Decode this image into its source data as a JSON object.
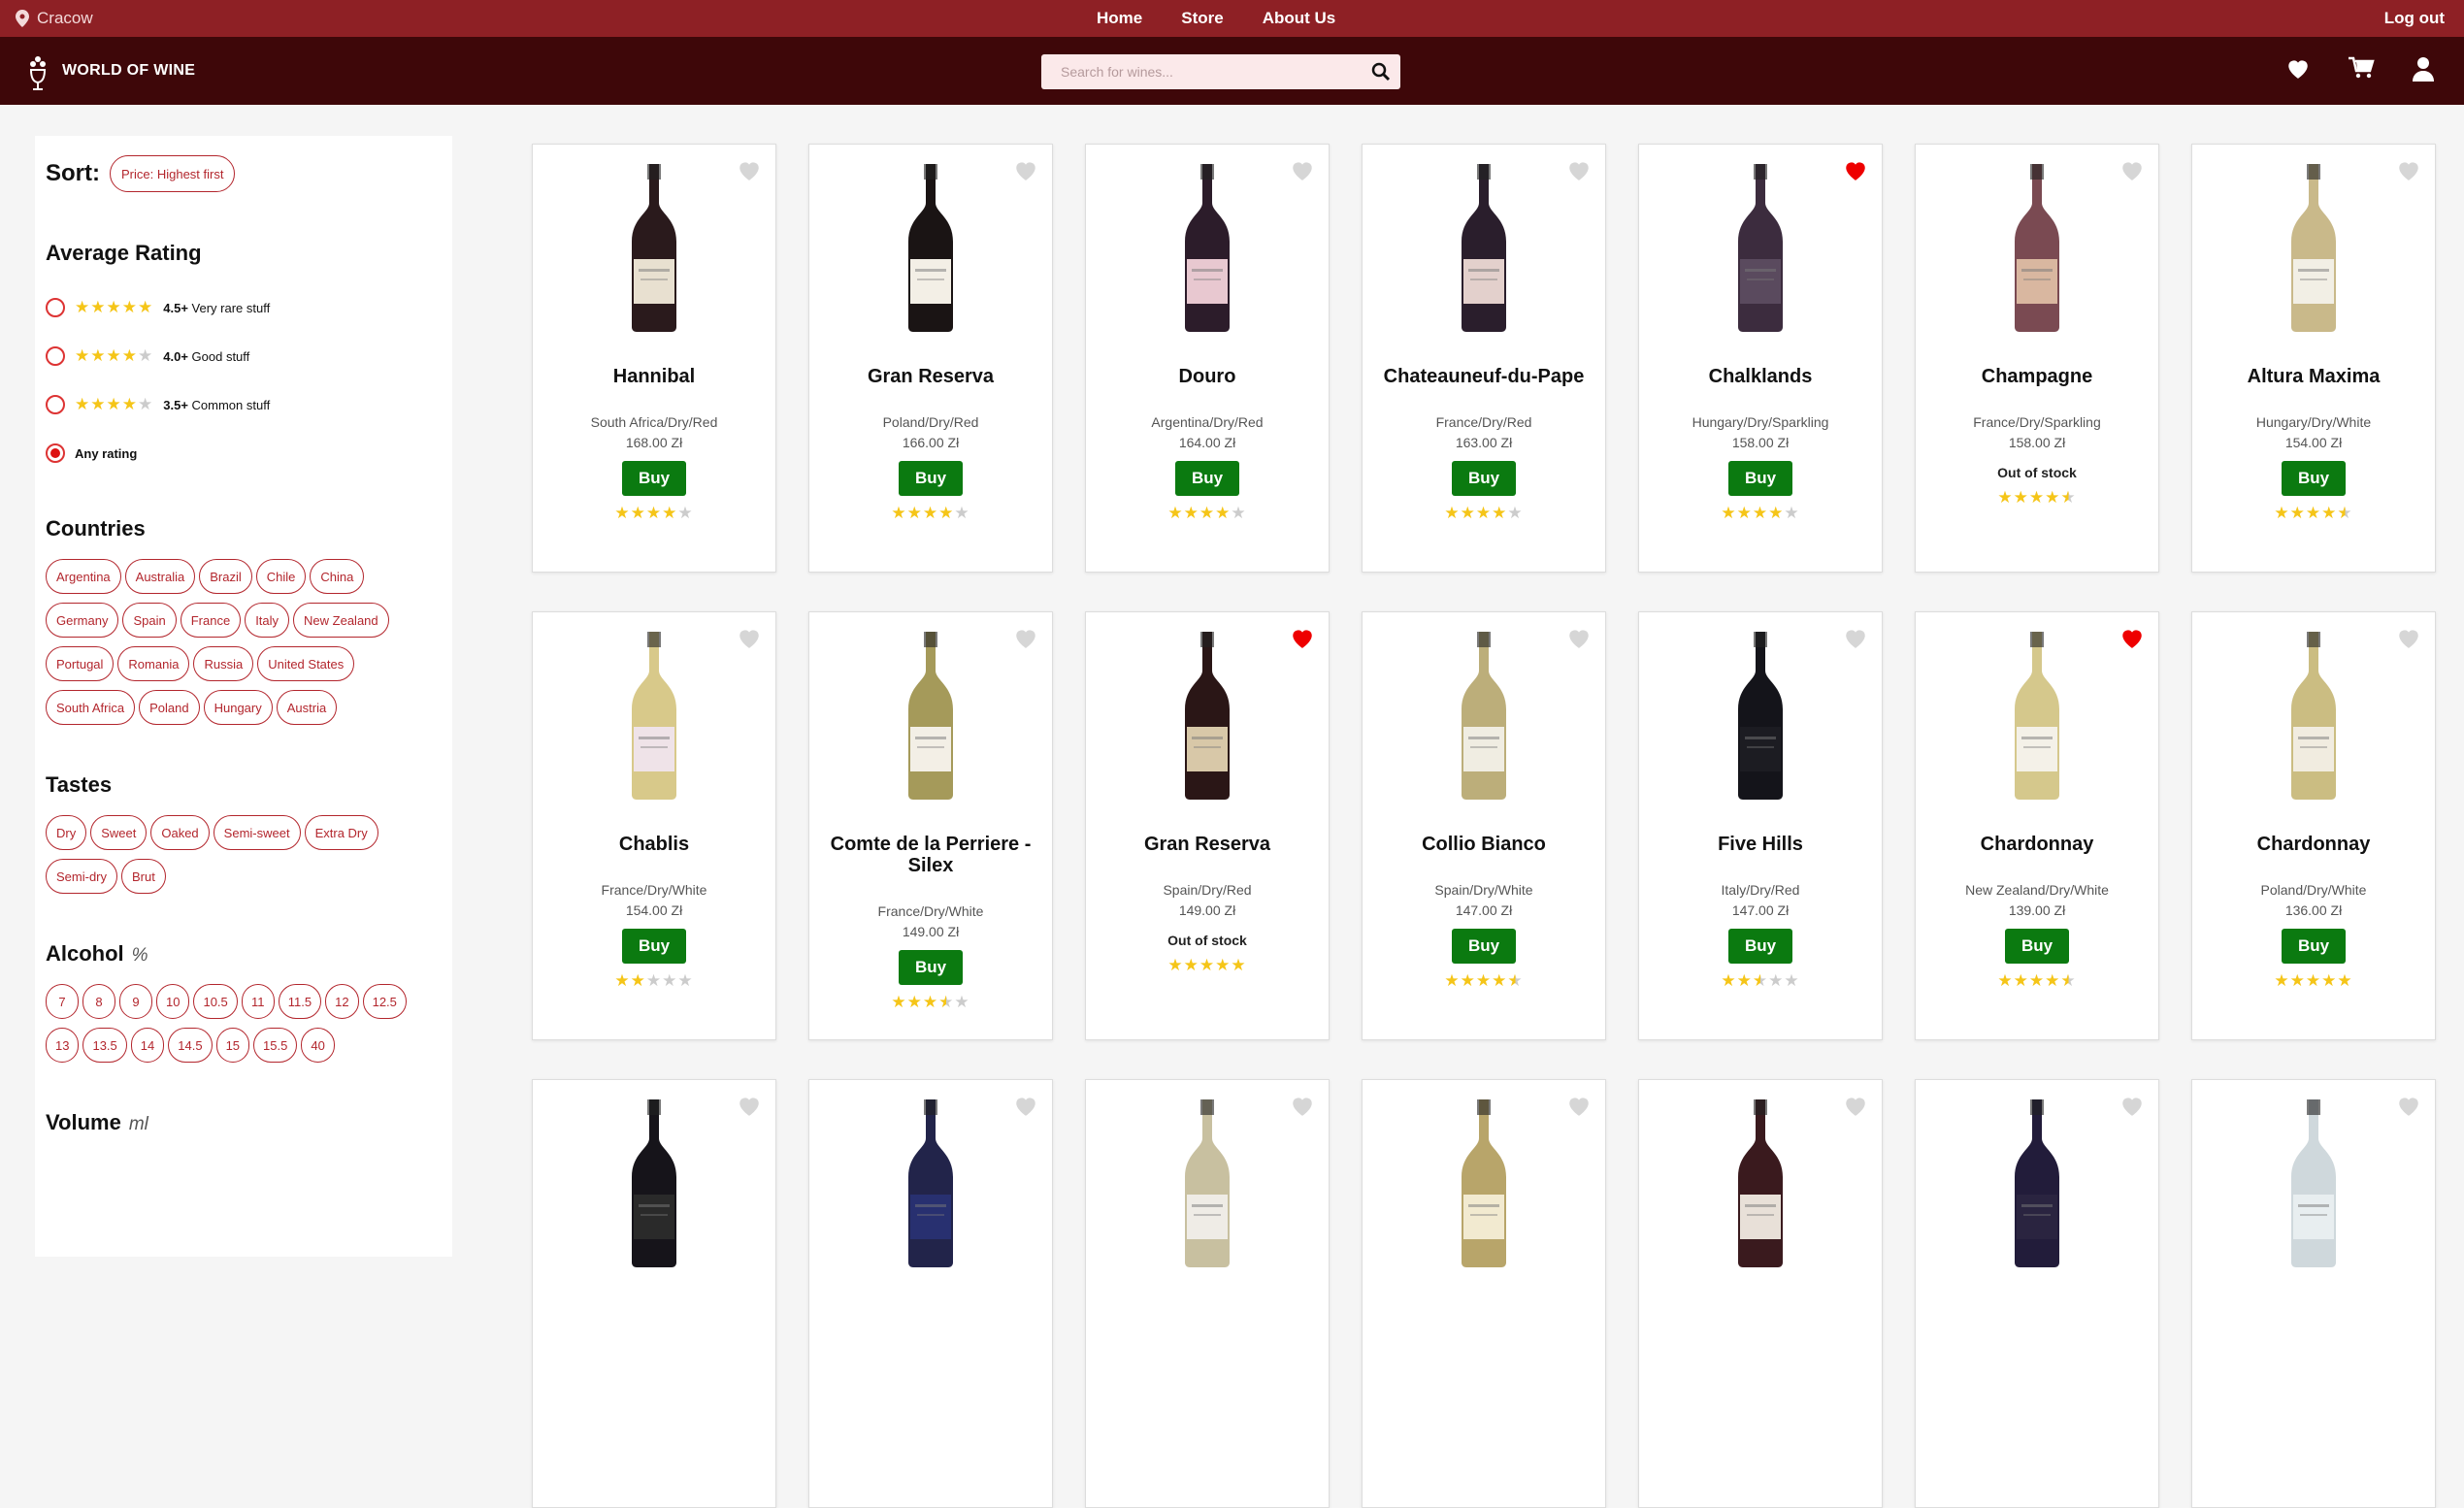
{
  "topbar": {
    "location": "Cracow",
    "nav": [
      "Home",
      "Store",
      "About Us"
    ],
    "logout": "Log out"
  },
  "header": {
    "brand": "WORLD OF WINE",
    "search_placeholder": "Search for wines..."
  },
  "sidebar": {
    "sort_label": "Sort:",
    "sort_value": "Price: Highest first",
    "rating_title": "Average Rating",
    "ratings": [
      {
        "stars": 4.5,
        "value": "4.5+",
        "text": "Very rare stuff",
        "selected": false
      },
      {
        "stars": 4,
        "value": "4.0+",
        "text": "Good stuff",
        "selected": false
      },
      {
        "stars": 3.5,
        "value": "3.5+",
        "text": "Common stuff",
        "selected": false
      },
      {
        "stars": 0,
        "value": "",
        "text": "Any rating",
        "selected": true
      }
    ],
    "countries_title": "Countries",
    "countries": [
      "Argentina",
      "Australia",
      "Brazil",
      "Chile",
      "China",
      "Germany",
      "Spain",
      "France",
      "Italy",
      "New Zealand",
      "Portugal",
      "Romania",
      "Russia",
      "United States",
      "South Africa",
      "Poland",
      "Hungary",
      "Austria"
    ],
    "tastes_title": "Tastes",
    "tastes": [
      "Dry",
      "Sweet",
      "Oaked",
      "Semi-sweet",
      "Extra Dry",
      "Semi-dry",
      "Brut"
    ],
    "alcohol_title": "Alcohol",
    "alcohol_unit": "%",
    "alcohol": [
      "7",
      "8",
      "9",
      "10",
      "10.5",
      "11",
      "11.5",
      "12",
      "12.5",
      "13",
      "13.5",
      "14",
      "14.5",
      "15",
      "15.5",
      "40"
    ],
    "volume_title": "Volume",
    "volume_unit": "ml"
  },
  "products": [
    {
      "name": "Hannibal",
      "meta": "South Africa/Dry/Red",
      "price": "168.00 Zł",
      "buy": "Buy",
      "rating": 4,
      "fav": false,
      "stock": true,
      "color": "#2a1a1c",
      "label": "#e8e0d0"
    },
    {
      "name": "Gran Reserva",
      "meta": "Poland/Dry/Red",
      "price": "166.00 Zł",
      "buy": "Buy",
      "rating": 4,
      "fav": false,
      "stock": true,
      "color": "#1a1414",
      "label": "#f3efe6"
    },
    {
      "name": "Douro",
      "meta": "Argentina/Dry/Red",
      "price": "164.00 Zł",
      "buy": "Buy",
      "rating": 4,
      "fav": false,
      "stock": true,
      "color": "#2c1c2a",
      "label": "#e8c8d0"
    },
    {
      "name": "Chateauneuf-du-Pape",
      "meta": "France/Dry/Red",
      "price": "163.00 Zł",
      "buy": "Buy",
      "rating": 4,
      "fav": false,
      "stock": true,
      "color": "#2a1e2c",
      "label": "#e3d0cc"
    },
    {
      "name": "Chalklands",
      "meta": "Hungary/Dry/Sparkling",
      "price": "158.00 Zł",
      "buy": "Buy",
      "rating": 4,
      "fav": true,
      "stock": true,
      "color": "#3c2c3e",
      "label": "#5a4a5e"
    },
    {
      "name": "Champagne",
      "meta": "France/Dry/Sparkling",
      "price": "158.00 Zł",
      "buy": "Buy",
      "rating": 4.5,
      "fav": false,
      "stock": false,
      "out_of_stock": "Out of stock",
      "color": "#7a4a52",
      "label": "#d9b7a0"
    },
    {
      "name": "Altura Maxima",
      "meta": "Hungary/Dry/White",
      "price": "154.00 Zł",
      "buy": "Buy",
      "rating": 4.5,
      "fav": false,
      "stock": true,
      "color": "#c9b98a",
      "label": "#f2efe5"
    },
    {
      "name": "Chablis",
      "meta": "France/Dry/White",
      "price": "154.00 Zł",
      "buy": "Buy",
      "rating": 2,
      "fav": false,
      "stock": true,
      "color": "#d8c98a",
      "label": "#efe3e8"
    },
    {
      "name": "Comte de la Perriere - Silex",
      "meta": "France/Dry/White",
      "price": "149.00 Zł",
      "buy": "Buy",
      "rating": 3.5,
      "fav": false,
      "stock": true,
      "color": "#a59a5a",
      "label": "#f3efe6"
    },
    {
      "name": "Gran Reserva",
      "meta": "Spain/Dry/Red",
      "price": "149.00 Zł",
      "buy": "Buy",
      "rating": 5,
      "fav": true,
      "stock": false,
      "out_of_stock": "Out of stock",
      "color": "#2a1616",
      "label": "#d8c8a8"
    },
    {
      "name": "Collio Bianco",
      "meta": "Spain/Dry/White",
      "price": "147.00 Zł",
      "buy": "Buy",
      "rating": 4.5,
      "fav": false,
      "stock": true,
      "color": "#bcae7a",
      "label": "#f0ede2"
    },
    {
      "name": "Five Hills",
      "meta": "Italy/Dry/Red",
      "price": "147.00 Zł",
      "buy": "Buy",
      "rating": 2.5,
      "fav": false,
      "stock": true,
      "color": "#14141a",
      "label": "#1c1c22"
    },
    {
      "name": "Chardonnay",
      "meta": "New Zealand/Dry/White",
      "price": "139.00 Zł",
      "buy": "Buy",
      "rating": 4.5,
      "fav": true,
      "stock": true,
      "color": "#d5c88c",
      "label": "#f4f1e8"
    },
    {
      "name": "Chardonnay",
      "meta": "Poland/Dry/White",
      "price": "136.00 Zł",
      "buy": "Buy",
      "rating": 5,
      "fav": false,
      "stock": true,
      "color": "#cbbd82",
      "label": "#f1ece0"
    },
    {
      "name": "",
      "meta": "",
      "price": "",
      "rating": 0,
      "fav": false,
      "stock": true,
      "partial": true,
      "color": "#16141a",
      "label": "#2a2a2a"
    },
    {
      "name": "",
      "meta": "",
      "price": "",
      "rating": 0,
      "fav": false,
      "stock": true,
      "partial": true,
      "color": "#22244a",
      "label": "#283070"
    },
    {
      "name": "",
      "meta": "",
      "price": "",
      "rating": 0,
      "fav": false,
      "stock": true,
      "partial": true,
      "color": "#c8c0a0",
      "label": "#efece6"
    },
    {
      "name": "",
      "meta": "",
      "price": "",
      "rating": 0,
      "fav": false,
      "stock": true,
      "partial": true,
      "color": "#b8a56a",
      "label": "#f2ead0"
    },
    {
      "name": "",
      "meta": "",
      "price": "",
      "rating": 0,
      "fav": false,
      "stock": true,
      "partial": true,
      "color": "#3a1a1e",
      "label": "#e8e0d8"
    },
    {
      "name": "",
      "meta": "",
      "price": "",
      "rating": 0,
      "fav": false,
      "stock": true,
      "partial": true,
      "color": "#221c3a",
      "label": "#2a2440"
    },
    {
      "name": "",
      "meta": "",
      "price": "",
      "rating": 0,
      "fav": false,
      "stock": true,
      "partial": true,
      "color": "#cfd8dc",
      "label": "#e8eef0"
    }
  ]
}
